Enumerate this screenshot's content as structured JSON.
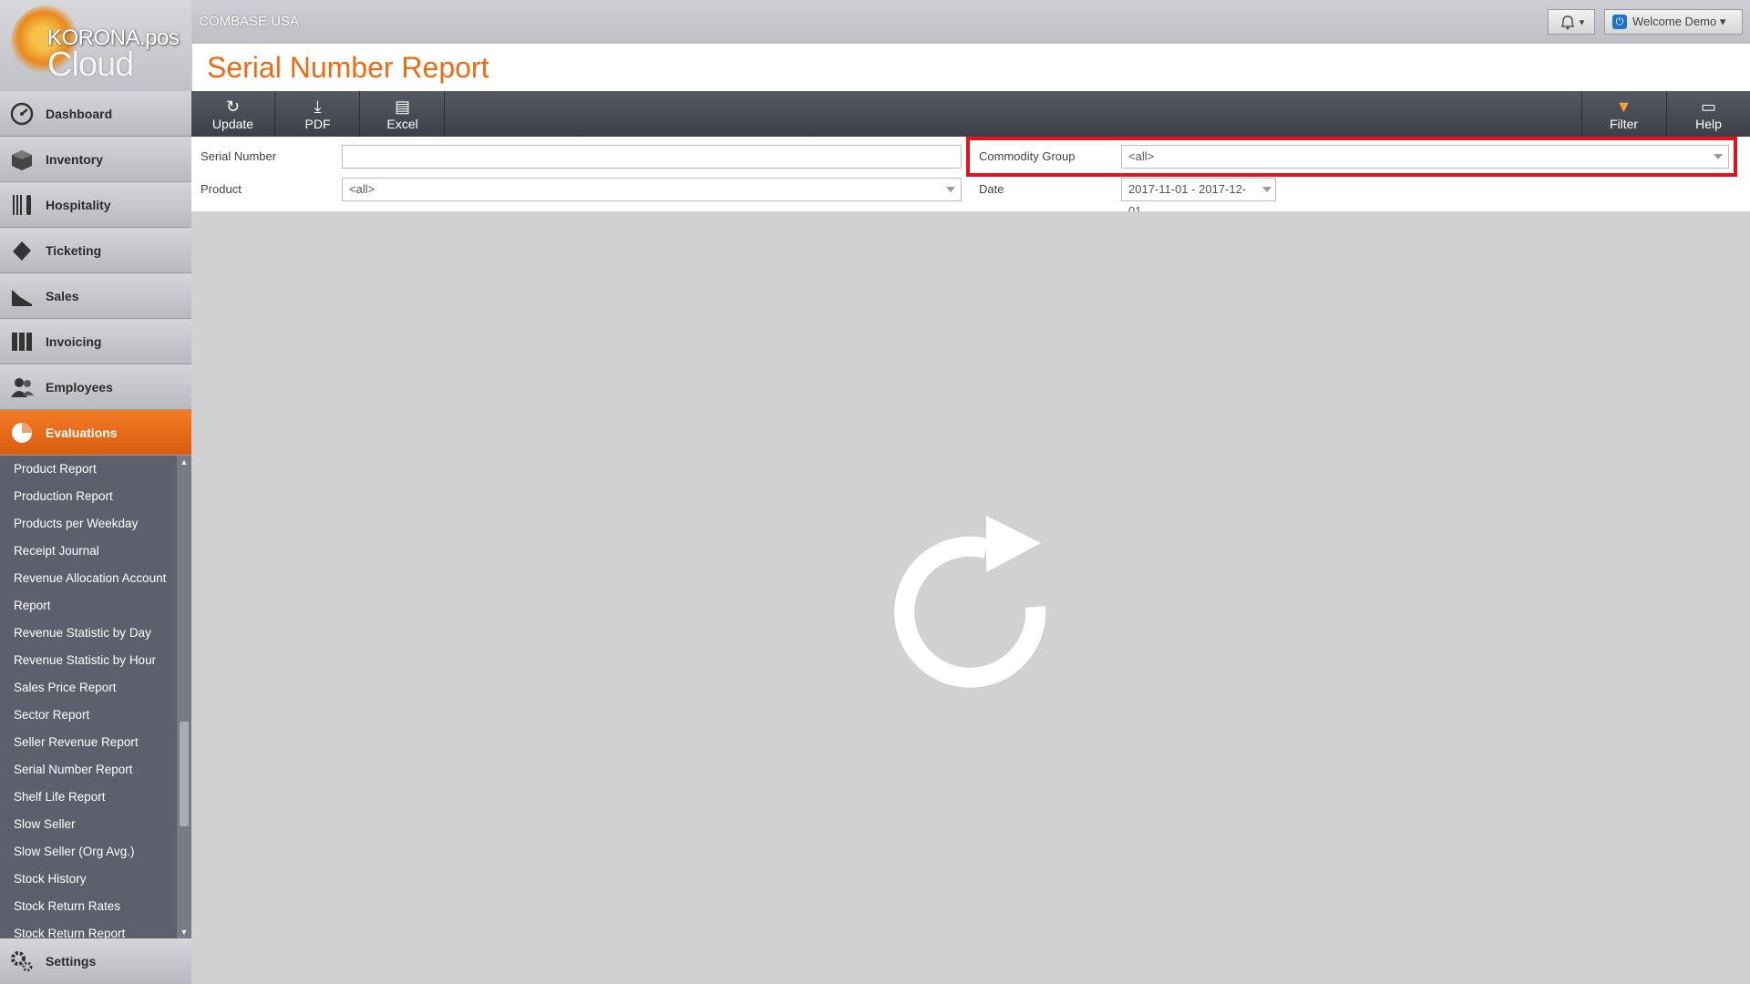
{
  "app": {
    "logo_line1": "KORONA.pos",
    "logo_line2": "Cloud",
    "company": "COMBASE USA",
    "welcome": "Welcome Demo ▾",
    "notif_caret": "▾",
    "accent_color": "#ef6b12",
    "highlight_color": "#e3121e"
  },
  "sidebar": {
    "items": [
      {
        "label": "Dashboard",
        "icon": "gauge-icon"
      },
      {
        "label": "Inventory",
        "icon": "box-icon"
      },
      {
        "label": "Hospitality",
        "icon": "cutlery-icon"
      },
      {
        "label": "Ticketing",
        "icon": "ticket-icon"
      },
      {
        "label": "Sales",
        "icon": "sales-icon"
      },
      {
        "label": "Invoicing",
        "icon": "binders-icon"
      },
      {
        "label": "Employees",
        "icon": "people-icon"
      },
      {
        "label": "Evaluations",
        "icon": "pie-chart-icon",
        "active": true
      }
    ],
    "submenu": [
      "Product Report",
      "Production Report",
      "Products per Weekday",
      "Receipt Journal",
      "Revenue Allocation Account",
      "Report",
      "Revenue Statistic by Day",
      "Revenue Statistic by Hour",
      "Sales Price Report",
      "Sector Report",
      "Seller Revenue Report",
      "Serial Number Report",
      "Shelf Life Report",
      "Slow Seller",
      "Slow Seller (Org Avg.)",
      "Stock History",
      "Stock Return Rates",
      "Stock Return Report"
    ],
    "settings_label": "Settings"
  },
  "page": {
    "title": "Serial Number Report"
  },
  "toolbar": {
    "update": "Update",
    "pdf": "PDF",
    "excel": "Excel",
    "filter": "Filter",
    "help": "Help"
  },
  "filters": {
    "serial_label": "Serial Number",
    "serial_value": "",
    "product_label": "Product",
    "product_value": "<all>",
    "commodity_label": "Commodity Group",
    "commodity_value": "<all>",
    "date_label": "Date",
    "date_value": "2017-11-01 - 2017-12-01"
  }
}
